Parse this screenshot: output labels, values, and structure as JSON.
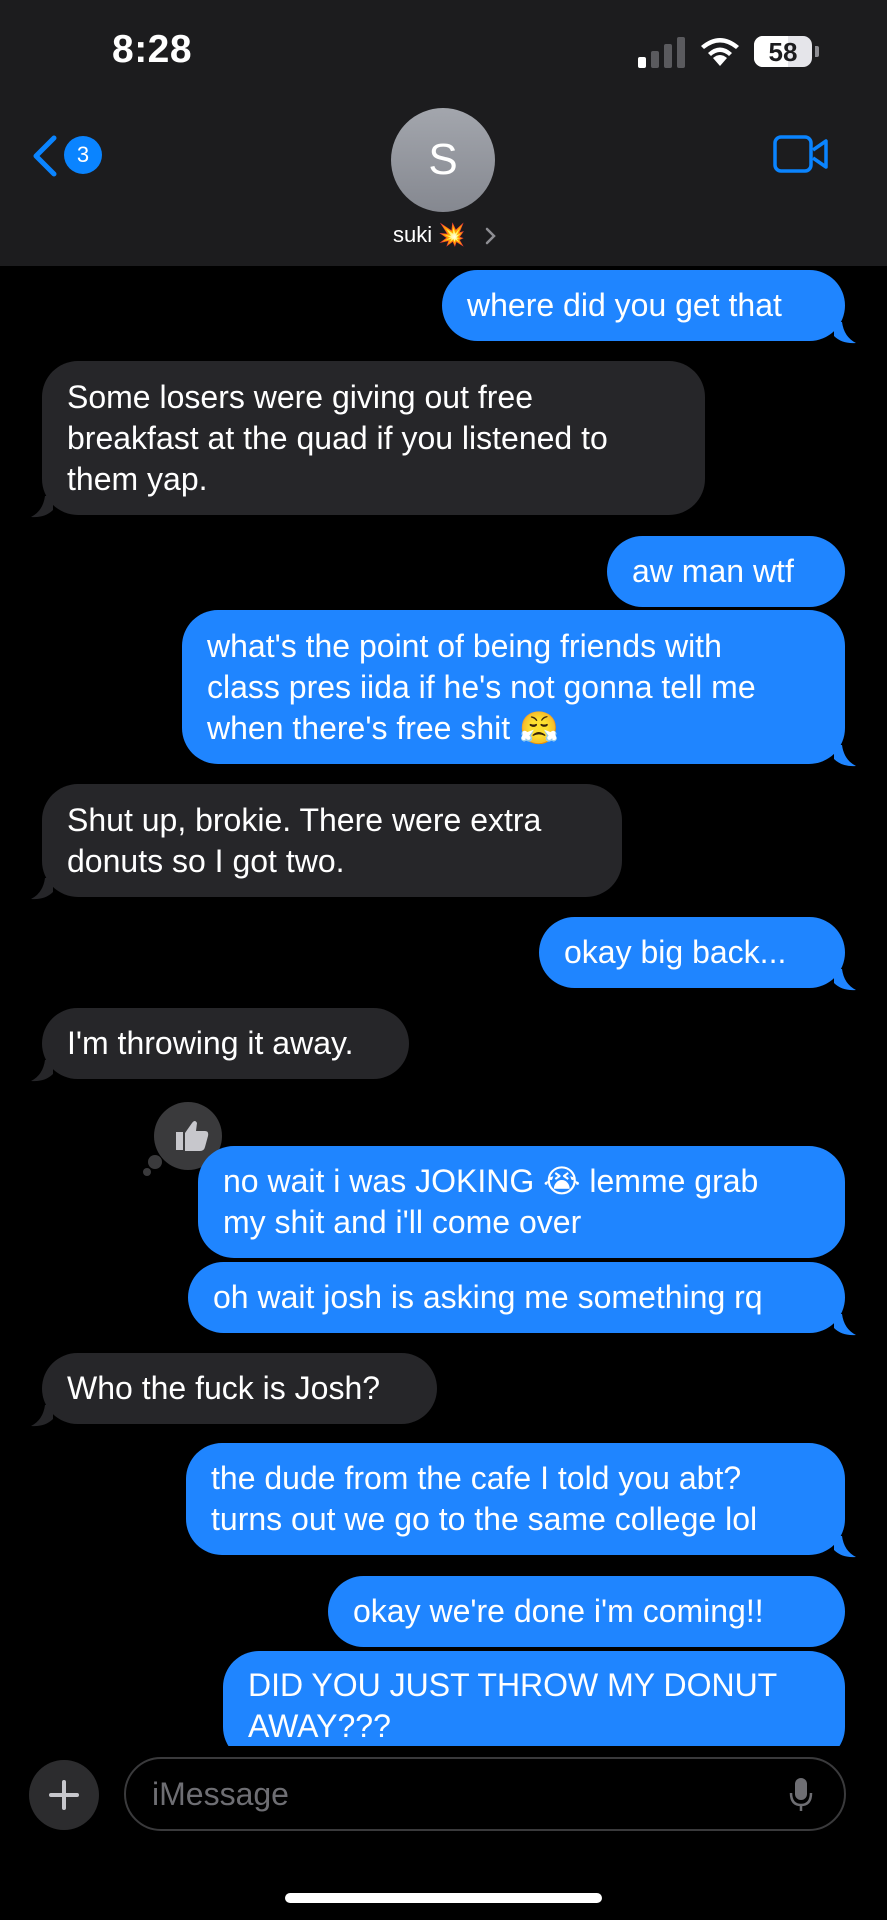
{
  "status_bar": {
    "time": "8:28",
    "battery": "58"
  },
  "header": {
    "back_count": "3",
    "avatar_initial": "S",
    "contact_name": "suki 💥",
    "icons": [
      "chevron-left-icon",
      "video-camera-icon",
      "chevron-right-icon",
      "wifi-icon",
      "signal-icon",
      "battery-icon"
    ]
  },
  "messages": [
    {
      "from": "me",
      "text": "where did you get that"
    },
    {
      "from": "them",
      "text": "Some losers were giving out free\nbreakfast at the quad if you listened to\nthem yap."
    },
    {
      "from": "me",
      "text": "aw man wtf"
    },
    {
      "from": "me",
      "text": "what's the point of being friends with\nclass pres iida if he's not gonna tell me\nwhen there's free shit 😤"
    },
    {
      "from": "them",
      "text": "Shut up, brokie. There were extra\ndonuts so I got two."
    },
    {
      "from": "me",
      "text": "okay big back..."
    },
    {
      "from": "them",
      "text": "I'm throwing it away."
    },
    {
      "from": "me",
      "text": "no wait i was JOKING 😭 lemme grab\nmy shit and i'll come over",
      "reaction": "thumbs-up"
    },
    {
      "from": "me",
      "text": "oh wait josh is asking me something rq"
    },
    {
      "from": "them",
      "text": "Who the fuck is Josh?"
    },
    {
      "from": "me",
      "text": "the dude from the cafe I told you abt?\nturns out we go to the same college lol"
    },
    {
      "from": "me",
      "text": "okay we're done i'm coming!!"
    },
    {
      "from": "me",
      "text": "DID YOU JUST THROW MY DONUT\nAWAY???"
    }
  ],
  "composer": {
    "placeholder": "iMessage"
  },
  "colors": {
    "sent": "#1f85ff",
    "received": "#262629",
    "accent": "#0a84ff",
    "background": "#000000"
  }
}
